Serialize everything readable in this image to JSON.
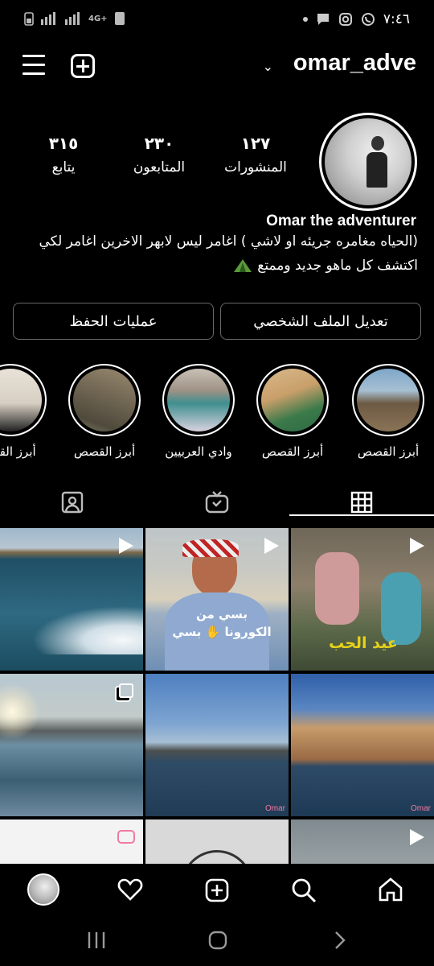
{
  "status_bar": {
    "time": "٧:٤٦",
    "network": "4G+"
  },
  "header": {
    "username": "omar_adve"
  },
  "profile": {
    "full_name": "Omar the adventurer",
    "stats": [
      {
        "value": "١٢٧",
        "label": "المنشورات"
      },
      {
        "value": "٢٣٠",
        "label": "المتابعون"
      },
      {
        "value": "٣١٥",
        "label": "يتابع"
      }
    ],
    "bio_line1": "(الحياه مغامره جريئه او لاشي ) اغامر ليس لابهر الاخرين اغامر لكي",
    "bio_line2": "اكتشف كل ماهو جديد وممتع"
  },
  "buttons": {
    "edit_profile": "تعديل الملف الشخصي",
    "saved_actions": "عمليات الحفظ"
  },
  "highlights": [
    {
      "label": "أبرز القصص"
    },
    {
      "label": "أبرز القصص"
    },
    {
      "label": "وادي العربيين"
    },
    {
      "label": "أبرز القصص"
    },
    {
      "label": "أبرز القص"
    }
  ],
  "grid": {
    "watermark": "Omar",
    "tile2_caption_1": "بسي من",
    "tile2_caption_2": "الكورونا ✋ بسي",
    "tile3_caption": "عيد الحب"
  },
  "colors": {
    "background": "#000000",
    "border": "#6a6a6a",
    "tile3_caption": "#e6d21a"
  }
}
